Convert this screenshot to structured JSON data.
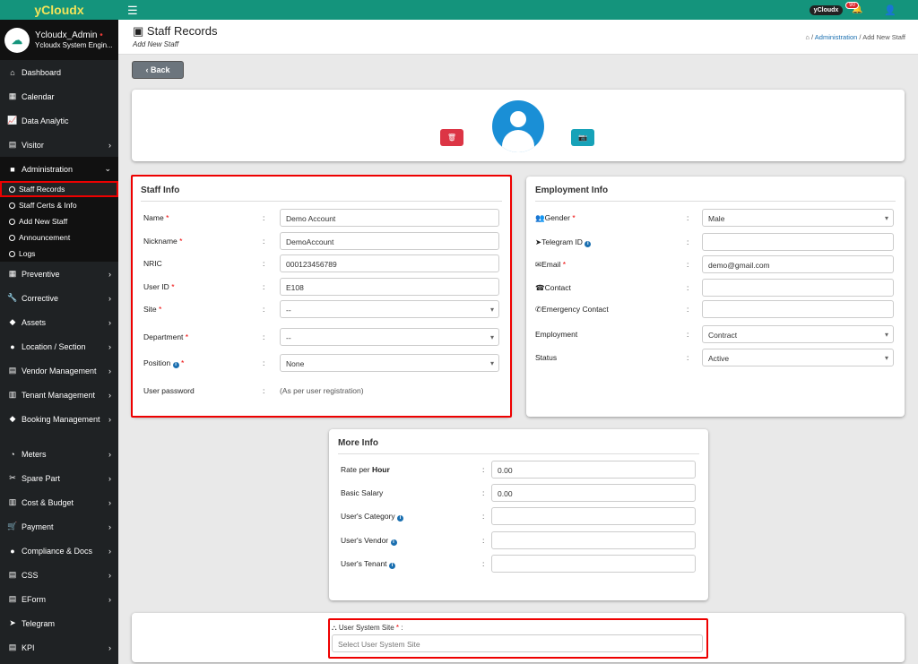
{
  "app": {
    "brand": "yCloudx",
    "pill": "yCloudx",
    "bell_count": "90"
  },
  "profile": {
    "name": "Ycloudx_Admin",
    "role": "Ycloudx System Engin..."
  },
  "sidebar": {
    "items_top": [
      {
        "label": "Dashboard",
        "icon": "home-icon",
        "glyph": "⌂"
      },
      {
        "label": "Calendar",
        "icon": "calendar-icon",
        "glyph": "▦"
      },
      {
        "label": "Data Analytic",
        "icon": "chart-icon",
        "glyph": "📈"
      },
      {
        "label": "Visitor",
        "icon": "id-card-icon",
        "glyph": "▤",
        "chev": "›"
      },
      {
        "label": "Administration",
        "icon": "admin-icon",
        "glyph": "■",
        "chev": "⌄"
      }
    ],
    "sub": [
      "Staff Records",
      "Staff Certs & Info",
      "Add New Staff",
      "Announcement",
      "Logs"
    ],
    "items_mid": [
      {
        "label": "Preventive",
        "icon": "calendar-icon",
        "glyph": "▦",
        "chev": "›"
      },
      {
        "label": "Corrective",
        "icon": "wrench-icon",
        "glyph": "🔧",
        "chev": "›"
      },
      {
        "label": "Assets",
        "icon": "tag-icon",
        "glyph": "◆",
        "chev": "›"
      },
      {
        "label": "Location / Section",
        "icon": "globe-icon",
        "glyph": "●",
        "chev": "›"
      },
      {
        "label": "Vendor Management",
        "icon": "id-card-icon",
        "glyph": "▤",
        "chev": "›"
      },
      {
        "label": "Tenant Management",
        "icon": "building-icon",
        "glyph": "▥",
        "chev": "›"
      },
      {
        "label": "Booking Management",
        "icon": "diamond-icon",
        "glyph": "◆",
        "chev": "›"
      }
    ],
    "items_bot": [
      {
        "label": "Meters",
        "icon": "meter-icon",
        "glyph": "◔",
        "chev": "›"
      },
      {
        "label": "Spare Part",
        "icon": "tools-icon",
        "glyph": "✂",
        "chev": "›"
      },
      {
        "label": "Cost & Budget",
        "icon": "bar-chart-icon",
        "glyph": "▥",
        "chev": "›"
      },
      {
        "label": "Payment",
        "icon": "cart-icon",
        "glyph": "🛒",
        "chev": "›"
      },
      {
        "label": "Compliance & Docs",
        "icon": "dot-icon",
        "glyph": "●",
        "chev": "›"
      },
      {
        "label": "CSS",
        "icon": "file-icon",
        "glyph": "▤",
        "chev": "›"
      },
      {
        "label": "EForm",
        "icon": "form-icon",
        "glyph": "▤",
        "chev": "›"
      },
      {
        "label": "Telegram",
        "icon": "telegram-icon",
        "glyph": "➤"
      },
      {
        "label": "KPI",
        "icon": "kpi-icon",
        "glyph": "▤",
        "chev": "›"
      }
    ]
  },
  "header": {
    "title": "Staff Records",
    "subtitle": "Add New Staff",
    "crumb_link": "Administration",
    "crumb_sep": "/",
    "crumb_current": "Add New Staff"
  },
  "back_label": "Back",
  "staff_info": {
    "title": "Staff Info",
    "fields": [
      {
        "label": "Name",
        "req": "*",
        "value": "Demo Account",
        "type": "text"
      },
      {
        "label": "Nickname",
        "req": "*",
        "value": "DemoAccount",
        "type": "text"
      },
      {
        "label": "NRIC",
        "req": "",
        "value": "000123456789",
        "type": "text"
      },
      {
        "label": "User ID",
        "req": "*",
        "value": "E108",
        "type": "text"
      },
      {
        "label": "Site",
        "req": "*",
        "value": "--",
        "type": "select"
      },
      {
        "label": "Department",
        "req": "*",
        "value": "--",
        "type": "select"
      },
      {
        "label": "Position",
        "req": "*",
        "value": "None",
        "type": "select",
        "info": true
      },
      {
        "label": "User password",
        "req": "",
        "value": "(As per user registration)",
        "type": "static"
      }
    ]
  },
  "employment_info": {
    "title": "Employment Info",
    "fields": [
      {
        "label": "Gender",
        "req": "*",
        "value": "Male",
        "type": "select",
        "icon": "users-icon",
        "glyph": "👥"
      },
      {
        "label": "Telegram ID",
        "req": "",
        "value": "",
        "type": "text",
        "icon": "telegram-icon",
        "glyph": "➤",
        "info": true
      },
      {
        "label": "Email",
        "req": "*",
        "value": "demo@gmail.com",
        "type": "text",
        "icon": "envelope-icon",
        "glyph": "✉"
      },
      {
        "label": "Contact",
        "req": "",
        "value": "",
        "type": "text",
        "icon": "phone-square-icon",
        "glyph": "☎"
      },
      {
        "label": "Emergency Contact",
        "req": "",
        "value": "",
        "type": "text",
        "icon": "phone-icon",
        "glyph": "✆"
      },
      {
        "label": "Employment",
        "req": "",
        "value": "Contract",
        "type": "select"
      },
      {
        "label": "Status",
        "req": "",
        "value": "Active",
        "type": "select"
      }
    ]
  },
  "more_info": {
    "title": "More Info",
    "fields": [
      {
        "label": "Rate per ",
        "bold": "Hour",
        "value": "0.00"
      },
      {
        "label": "Basic Salary",
        "value": "0.00"
      },
      {
        "label": "User's Category",
        "value": "",
        "info": true
      },
      {
        "label": "User's Vendor",
        "value": "",
        "info": true
      },
      {
        "label": "User's Tenant",
        "value": "",
        "info": true
      }
    ]
  },
  "system_site": {
    "label": "User System Site",
    "req": "*",
    "colon": ":",
    "placeholder": "Select User System Site"
  }
}
